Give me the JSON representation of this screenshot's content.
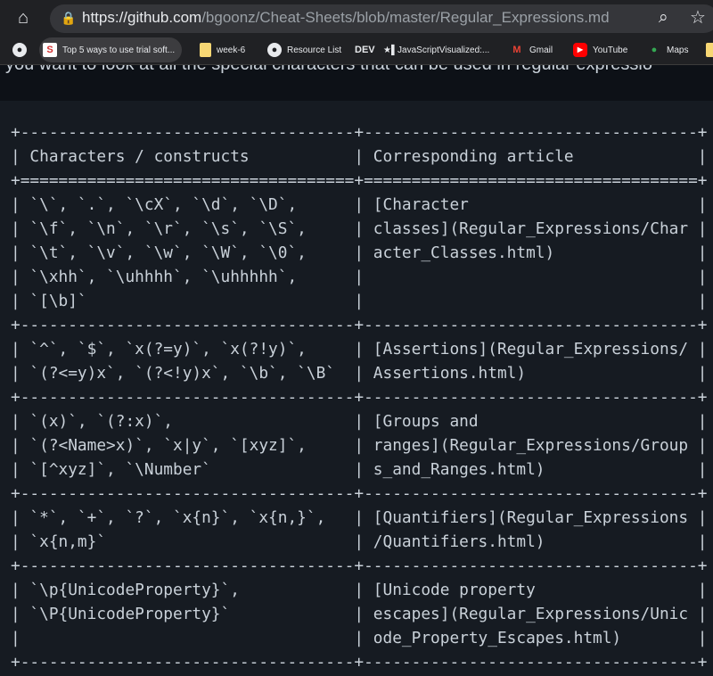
{
  "browser": {
    "url_host": "https://github.com",
    "url_path": "/bgoonz/Cheat-Sheets/blob/master/Regular_Expressions.md",
    "bookmarks": [
      {
        "label": "",
        "icon": "globe-icon"
      },
      {
        "label": "Top 5 ways to use trial soft...",
        "icon": "s-logo-icon"
      },
      {
        "label": "week-6",
        "icon": "folder-icon"
      },
      {
        "label": "Resource List",
        "icon": "globe-icon"
      },
      {
        "label": "DEV",
        "icon": "dev-icon"
      },
      {
        "label": "★▌JavaScriptVisualized:...",
        "icon": "star-icon"
      },
      {
        "label": "Gmail",
        "icon": "gmail-icon"
      },
      {
        "label": "YouTube",
        "icon": "youtube-icon"
      },
      {
        "label": "Maps",
        "icon": "maps-icon"
      }
    ]
  },
  "page": {
    "intro_text": "you want to look at all the special characters that can be used in regular expressio",
    "table": {
      "header": [
        "Characters / constructs",
        "Corresponding article"
      ],
      "rows": [
        {
          "left": [
            "`\\`, `.`, `\\cX`, `\\d`, `\\D`,",
            "`\\f`, `\\n`, `\\r`, `\\s`, `\\S`,",
            "`\\t`, `\\v`, `\\w`, `\\W`, `\\0`,",
            "`\\xhh`, `\\uhhhh`, `\\uhhhhh`,",
            "`[\\b]`"
          ],
          "right": [
            "[Character",
            "classes](Regular_Expressions/Char",
            "acter_Classes.html)"
          ]
        },
        {
          "left": [
            "`^`, `$`, `x(?=y)`, `x(?!y)`,",
            "`(?<=y)x`, `(?<!y)x`, `\\b`, `\\B`"
          ],
          "right": [
            "[Assertions](Regular_Expressions/",
            "Assertions.html)"
          ]
        },
        {
          "left": [
            "`(x)`, `(?:x)`,",
            "`(?<Name>x)`, `x|y`, `[xyz]`,",
            "`[^xyz]`, `\\Number`"
          ],
          "right": [
            "[Groups and",
            "ranges](Regular_Expressions/Group",
            "s_and_Ranges.html)"
          ]
        },
        {
          "left": [
            "`*`, `+`, `?`, `x{n}`, `x{n,}`,",
            "`x{n,m}`"
          ],
          "right": [
            "[Quantifiers](Regular_Expressions",
            "/Quantifiers.html)"
          ]
        },
        {
          "left": [
            "`\\p{UnicodeProperty}`,",
            "`\\P{UnicodeProperty}`"
          ],
          "right": [
            "[Unicode property",
            "escapes](Regular_Expressions/Unic",
            "ode_Property_Escapes.html)"
          ]
        }
      ]
    }
  }
}
